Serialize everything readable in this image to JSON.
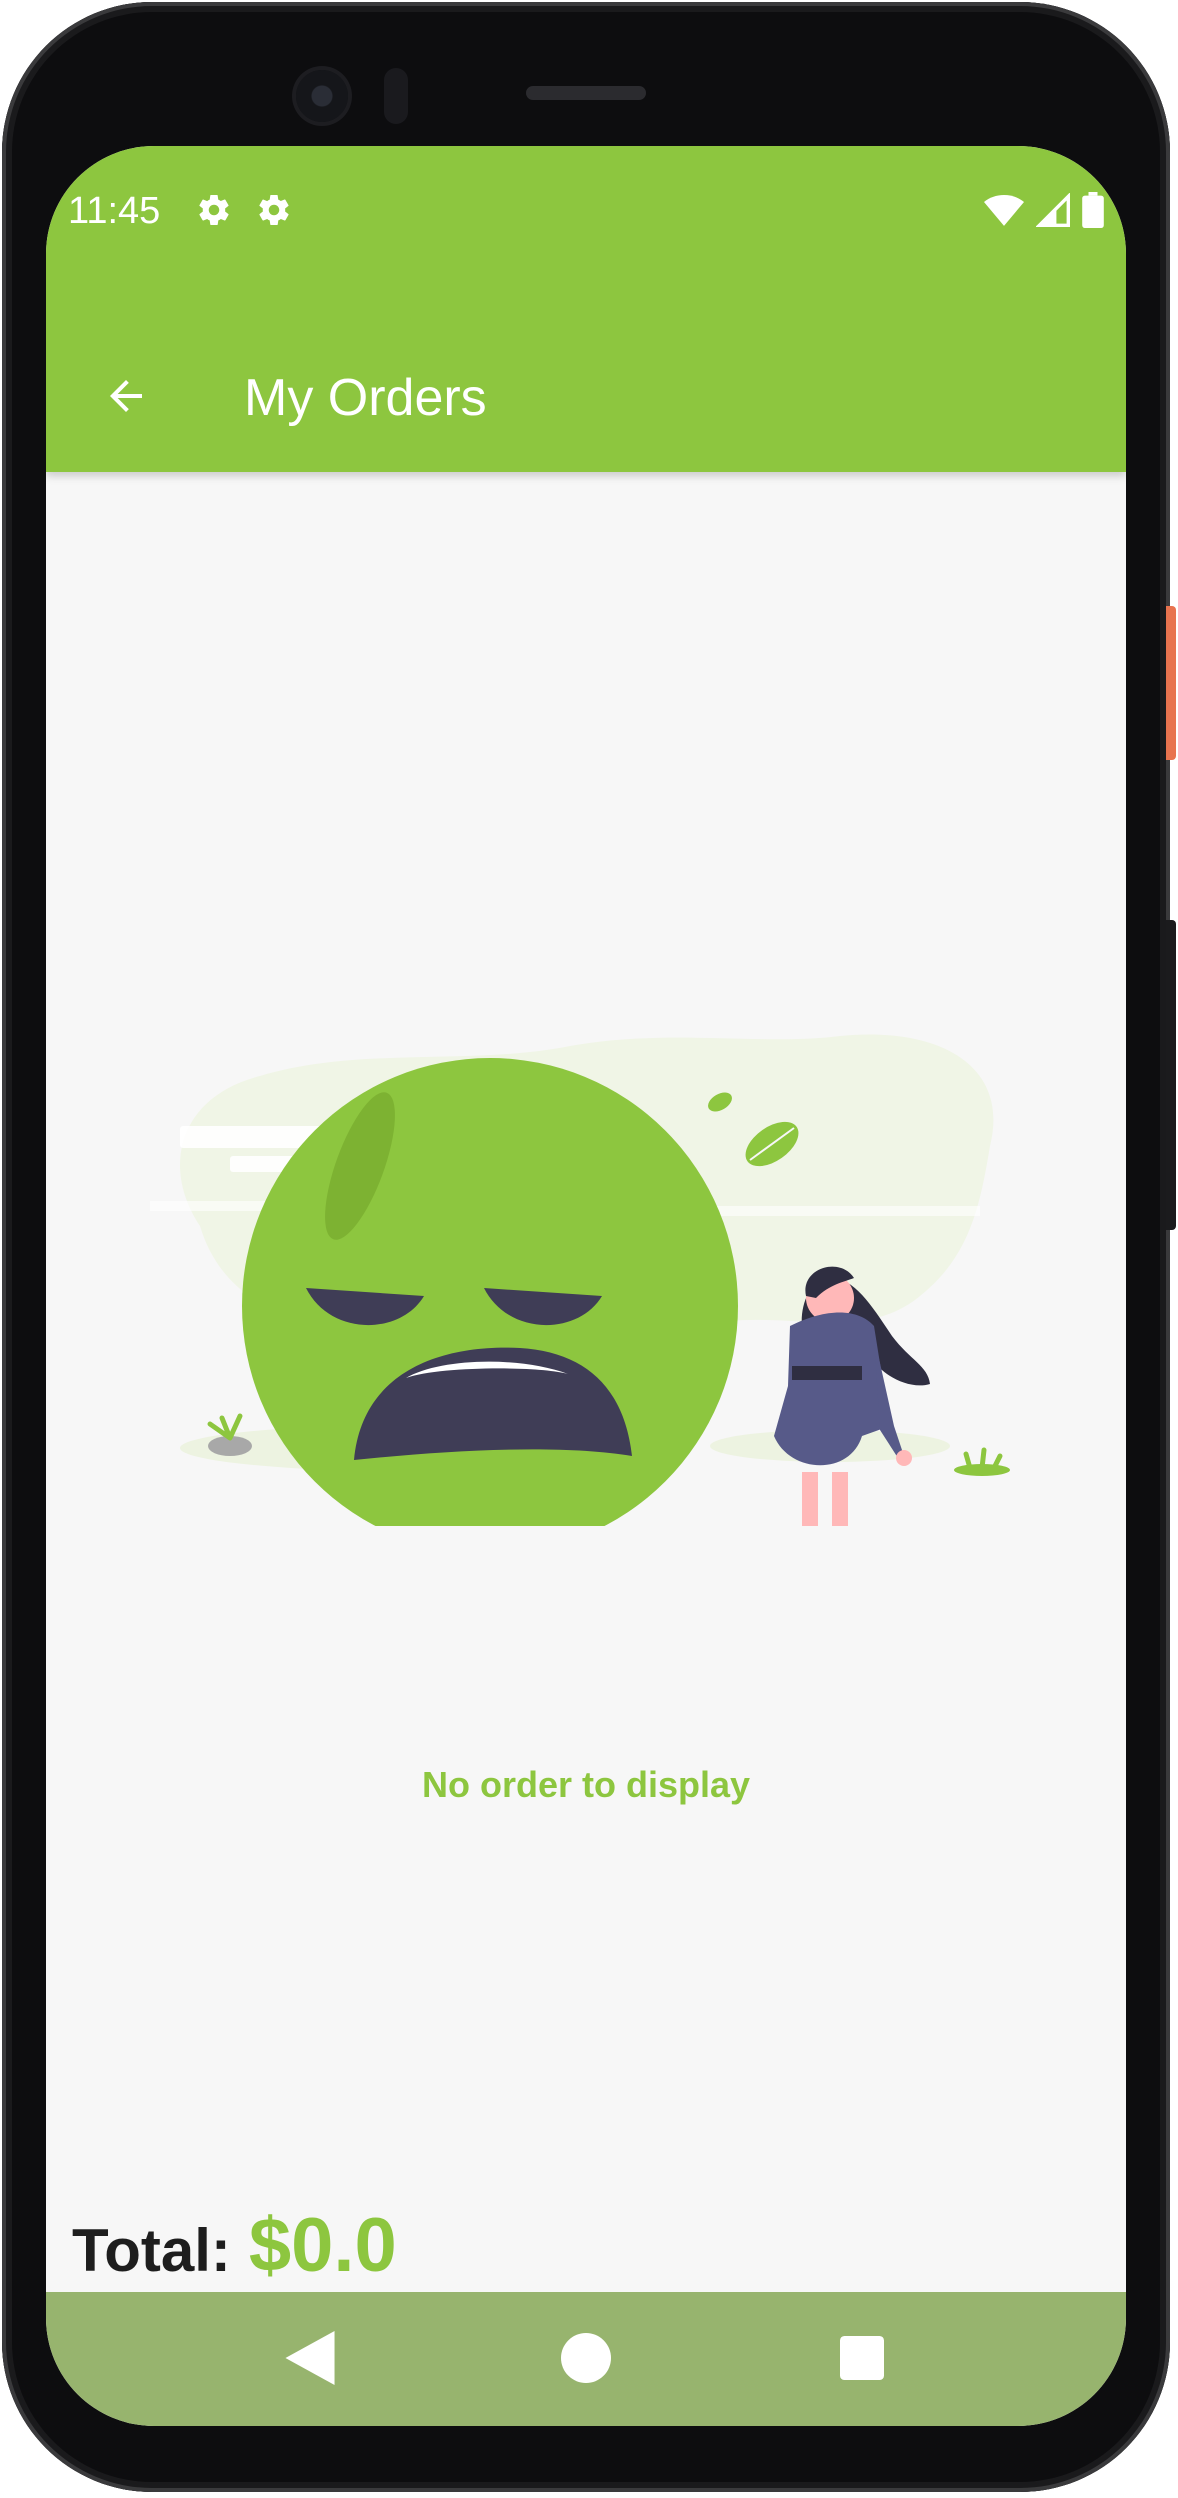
{
  "status_bar": {
    "time": "11:45",
    "left_icons": [
      "gear-icon",
      "gear-icon"
    ],
    "right_icons": [
      "wifi-icon",
      "cell-signal-icon",
      "battery-icon"
    ]
  },
  "app_bar": {
    "title": "My Orders",
    "back_icon": "arrow-left-icon",
    "color": "#8dc63f"
  },
  "empty_state": {
    "message": "No order to display",
    "illustration": "sad-face-with-woman"
  },
  "footer": {
    "total_label": "Total:",
    "total_value": "$0.0"
  },
  "nav_bar": {
    "buttons": [
      "back-triangle-icon",
      "home-circle-icon",
      "recents-square-icon"
    ],
    "color": "#97b46e"
  },
  "colors": {
    "accent": "#8dc63f",
    "background": "#f7f7f7",
    "text_dark": "#1e1e1e"
  }
}
